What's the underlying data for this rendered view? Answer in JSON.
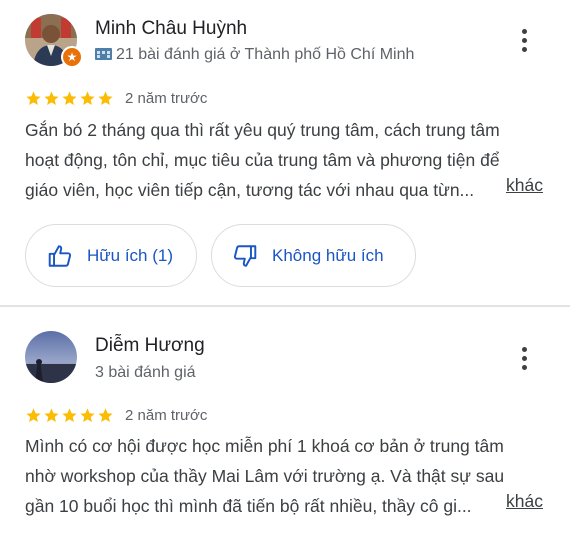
{
  "reviews": [
    {
      "author_name": "Minh Châu Huỳnh",
      "meta": "21 bài đánh giá ở Thành phố Hồ Chí Minh",
      "is_local_guide": true,
      "rating": 5,
      "date": "2 năm trước",
      "text_lines": [
        "Gắn bó 2 tháng qua thì rất yêu quý trung tâm, cách trung tâm",
        "hoạt động, tôn chỉ, mục tiêu của trung tâm và phương tiện để",
        "giáo viên, học viên tiếp cận, tương tác với nhau qua từn..."
      ],
      "more_label": "khác",
      "helpful_label": "Hữu ích (1)",
      "not_helpful_label": "Không hữu ích"
    },
    {
      "author_name": "Diễm Hương",
      "meta": "3 bài đánh giá",
      "is_local_guide": false,
      "rating": 5,
      "date": "2 năm trước",
      "text_lines": [
        "Mình có cơ hội được học miễn phí 1 khoá cơ bản ở trung tâm",
        "nhờ workshop của thầy Mai Lâm với trường ạ. Và thật sự sau",
        "gần 10 buổi học thì mình đã tiến bộ rất nhiều, thầy cô gi..."
      ],
      "more_label": "khác"
    }
  ],
  "colors": {
    "star": "#fbbc04",
    "accent_blue": "#1a56c4",
    "local_guide_badge": "#e8710a",
    "text_primary": "#202124",
    "text_secondary": "#5f6368"
  },
  "icons": {
    "more": "more-vert-icon",
    "thumbs_up": "thumbs-up-icon",
    "thumbs_down": "thumbs-down-icon",
    "local_guide": "local-guide-icon",
    "star": "star-icon"
  }
}
